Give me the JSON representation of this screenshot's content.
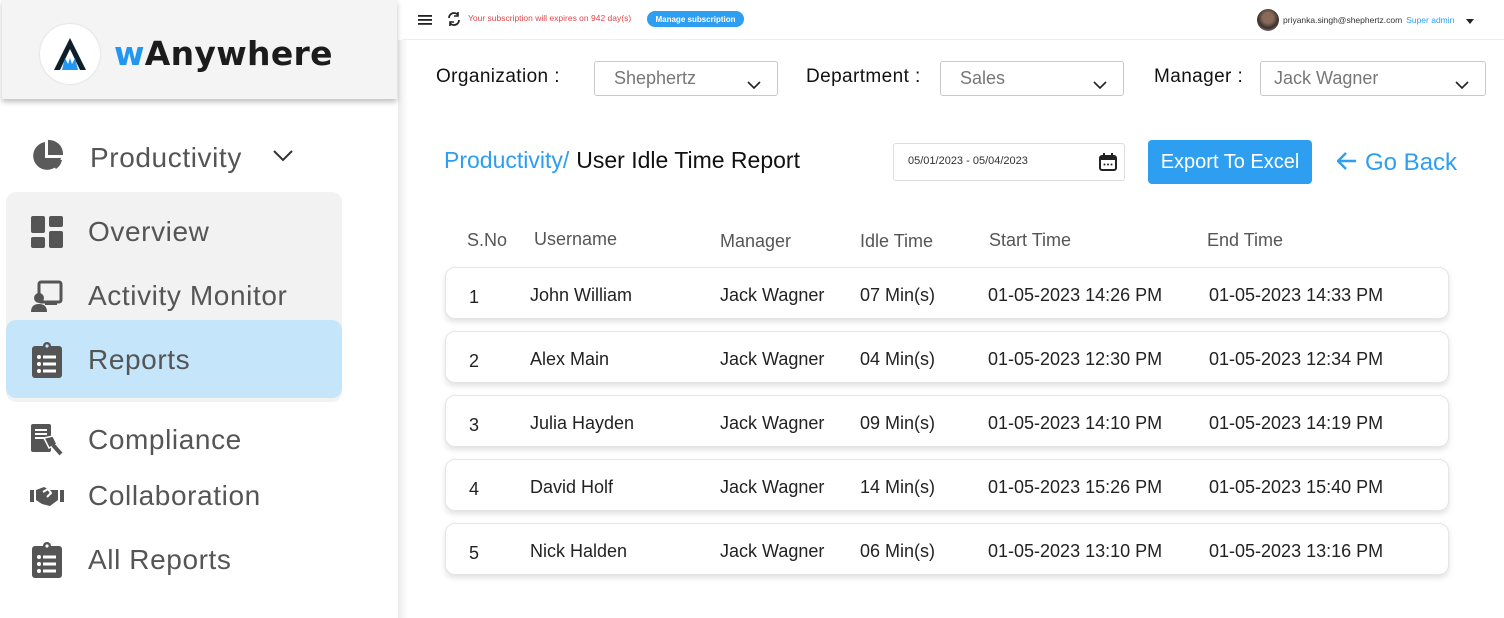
{
  "brand": {
    "prefix": "w",
    "name": "Anywhere"
  },
  "sidebar": {
    "section": {
      "label": "Productivity",
      "icon": "pie-chart-icon"
    },
    "submenu": [
      {
        "label": "Overview",
        "icon": "dashboard-icon"
      },
      {
        "label": "Activity Monitor",
        "icon": "activity-monitor-icon"
      },
      {
        "label": "Reports",
        "icon": "clipboard-list-icon",
        "active": true
      }
    ],
    "items": [
      {
        "label": "Compliance",
        "icon": "compliance-icon"
      },
      {
        "label": "Collaboration",
        "icon": "handshake-icon"
      },
      {
        "label": "All Reports",
        "icon": "clipboard-list-icon"
      }
    ]
  },
  "topbar": {
    "subscription_text": "Your subscription will expires on 942 day(s)",
    "manage_label": "Manage subscription",
    "user_email": "priyanka.singh@shephertz.com",
    "user_role": "Super admin"
  },
  "filters": {
    "organization": {
      "label": "Organization :",
      "value": "Shephertz"
    },
    "department": {
      "label": "Department :",
      "value": "Sales"
    },
    "manager": {
      "label": "Manager :",
      "value": "Jack Wagner"
    }
  },
  "header": {
    "crumb": "Productivity/",
    "title": "User Idle Time Report",
    "date_range": "05/01/2023 - 05/04/2023",
    "export_label": "Export To Excel",
    "goback_label": "Go Back"
  },
  "colors": {
    "accent": "#2e9ef0",
    "active_bg": "#c5e5fb",
    "warning": "#e0474c"
  },
  "table": {
    "columns": [
      "S.No",
      "Username",
      "Manager",
      "Idle Time",
      "Start Time",
      "End Time"
    ],
    "rows": [
      [
        "1",
        "John William",
        "Jack Wagner",
        "07 Min(s)",
        "01-05-2023 14:26 PM",
        "01-05-2023 14:33 PM"
      ],
      [
        "2",
        "Alex Main",
        "Jack Wagner",
        "04 Min(s)",
        "01-05-2023 12:30 PM",
        "01-05-2023 12:34 PM"
      ],
      [
        "3",
        "Julia Hayden",
        "Jack Wagner",
        "09 Min(s)",
        "01-05-2023 14:10 PM",
        "01-05-2023 14:19 PM"
      ],
      [
        "4",
        "David Holf",
        "Jack Wagner",
        "14 Min(s)",
        "01-05-2023 15:26 PM",
        "01-05-2023 15:40 PM"
      ],
      [
        "5",
        "Nick Halden",
        "Jack Wagner",
        "06 Min(s)",
        "01-05-2023 13:10 PM",
        "01-05-2023 13:16 PM"
      ]
    ]
  }
}
